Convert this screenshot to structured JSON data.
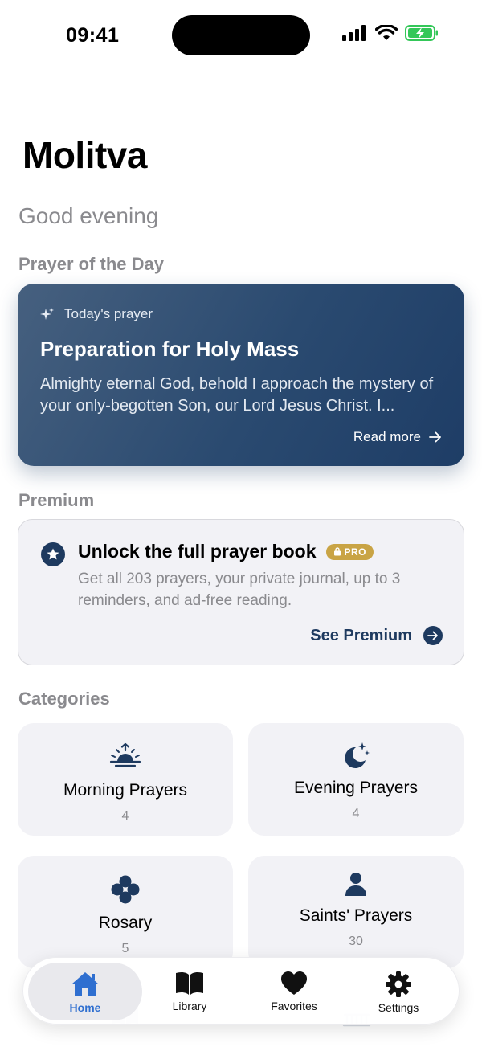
{
  "status": {
    "time": "09:41"
  },
  "header": {
    "title": "Molitva",
    "greeting": "Good evening"
  },
  "sections": {
    "prayer_of_day": "Prayer of the Day",
    "premium": "Premium",
    "categories": "Categories"
  },
  "prayer_card": {
    "eyebrow": "Today's prayer",
    "title": "Preparation for Holy Mass",
    "excerpt": "Almighty eternal God, behold I approach the mystery of your only-begotten Son, our Lord Jesus Christ. I...",
    "read_more": "Read more"
  },
  "premium_card": {
    "title": "Unlock the full prayer book",
    "badge": "PRO",
    "description": "Get all 203 prayers, your private journal, up to 3 reminders, and ad-free reading.",
    "cta": "See Premium"
  },
  "categories": [
    {
      "name": "Morning Prayers",
      "count": "4",
      "icon": "sunrise-icon"
    },
    {
      "name": "Evening Prayers",
      "count": "4",
      "icon": "moon-stars-icon"
    },
    {
      "name": "Rosary",
      "count": "5",
      "icon": "rosary-icon"
    },
    {
      "name": "Saints' Prayers",
      "count": "30",
      "icon": "person-icon"
    }
  ],
  "tab_bar": {
    "tabs": [
      {
        "label": "Home",
        "icon": "house-icon",
        "active": true
      },
      {
        "label": "Library",
        "icon": "book-icon",
        "active": false
      },
      {
        "label": "Favorites",
        "icon": "heart-icon",
        "active": false
      },
      {
        "label": "Settings",
        "icon": "gear-icon",
        "active": false
      }
    ]
  },
  "colors": {
    "navy": "#1e3a5f",
    "accent_blue": "#2f6fd0",
    "pro_gold": "#c9a445",
    "muted": "#8a8a8e",
    "tile_bg": "#f2f2f6"
  }
}
